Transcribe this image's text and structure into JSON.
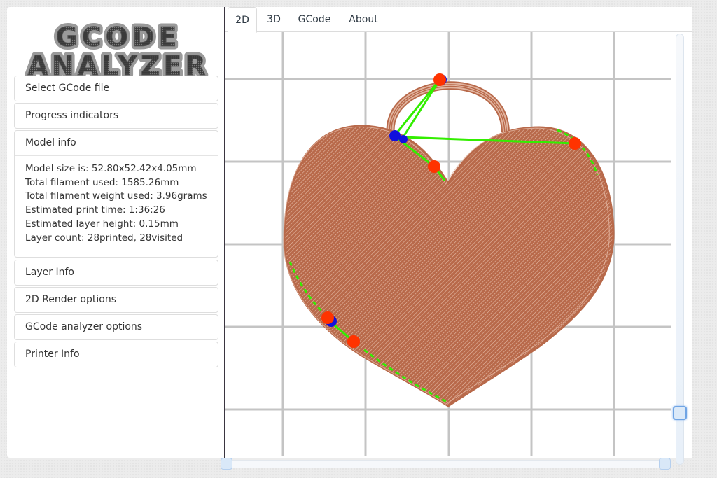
{
  "logo": {
    "line1": "GCODE",
    "line2": "ANALYZER"
  },
  "sidebar": {
    "sections": [
      {
        "label": "Select GCode file"
      },
      {
        "label": "Progress indicators"
      },
      {
        "label": "Model info",
        "expanded": true,
        "lines": [
          "Model size is: 52.80x52.42x4.05mm",
          "Total filament used: 1585.26mm",
          "Total filament weight used: 3.96grams",
          "Estimated print time: 1:36:26",
          "Estimated layer height: 0.15mm",
          "Layer count: 28printed, 28visited"
        ]
      },
      {
        "label": "Layer Info"
      },
      {
        "label": "2D Render options"
      },
      {
        "label": "GCode analyzer options"
      },
      {
        "label": "Printer Info"
      }
    ]
  },
  "tabs": [
    {
      "label": "2D",
      "active": true
    },
    {
      "label": "3D",
      "active": false
    },
    {
      "label": "GCode",
      "active": false
    },
    {
      "label": "About",
      "active": false
    }
  ],
  "colors": {
    "grid": "#c4c4c4",
    "extrusion": "#b8694a",
    "extrusion_light": "#e8c3b1",
    "travel_move": "#33ee00",
    "retract_point": "#ff3300",
    "restart_point": "#1010dd",
    "slider_handle": "#d9e8f8",
    "slider_active_border": "#6fa4e4"
  },
  "sliders": {
    "layer_slider": {
      "orientation": "vertical",
      "value_fraction": 1.0
    },
    "progress_slider": {
      "orientation": "horizontal",
      "range_fraction": [
        0.0,
        1.0
      ]
    }
  }
}
